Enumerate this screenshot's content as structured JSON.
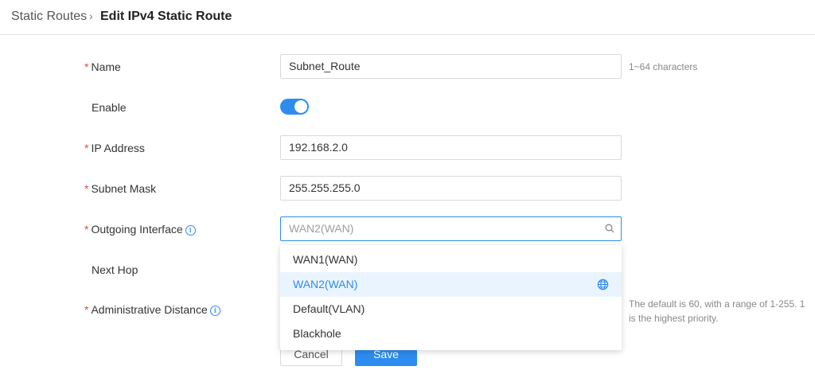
{
  "breadcrumb": {
    "root": "Static Routes",
    "separator": "›",
    "current": "Edit IPv4 Static Route"
  },
  "form": {
    "name_label": "Name",
    "name_value": "Subnet_Route",
    "name_hint": "1~64 characters",
    "enable_label": "Enable",
    "enable_on": true,
    "ip_label": "IP Address",
    "ip_value": "192.168.2.0",
    "mask_label": "Subnet Mask",
    "mask_value": "255.255.255.0",
    "iface_label": "Outgoing Interface",
    "iface_placeholder": "WAN2(WAN)",
    "nexthop_label": "Next Hop",
    "admin_label": "Administrative Distance",
    "admin_hint_line1": "The default is 60, with a range of 1-255. 1",
    "admin_hint_line2": "is the highest priority.",
    "required_mark": "*",
    "info_glyph": "i"
  },
  "dropdown": {
    "options": [
      "WAN1(WAN)",
      "WAN2(WAN)",
      "Default(VLAN)",
      "Blackhole"
    ],
    "selected": "WAN2(WAN)"
  },
  "buttons": {
    "cancel": "Cancel",
    "save": "Save"
  },
  "colors": {
    "accent": "#2d8cf0",
    "required": "#e74c3c"
  },
  "icons": {
    "search": "search-icon",
    "globe": "globe-icon",
    "info": "info-icon"
  }
}
